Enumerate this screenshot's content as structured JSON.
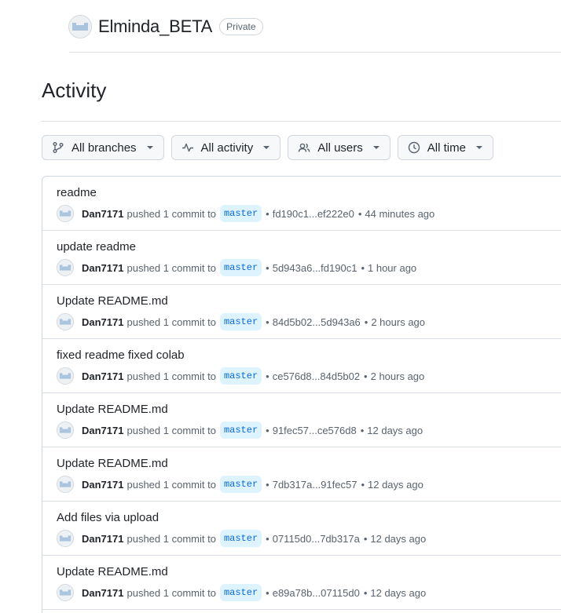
{
  "repo": {
    "name": "Elminda_BETA",
    "visibility": "Private",
    "avatar_icon": "identicon"
  },
  "page": {
    "title": "Activity"
  },
  "filters": [
    {
      "label": "All branches",
      "icon": "git-branch-icon"
    },
    {
      "label": "All activity",
      "icon": "pulse-icon"
    },
    {
      "label": "All users",
      "icon": "people-icon"
    },
    {
      "label": "All time",
      "icon": "clock-icon"
    }
  ],
  "activity": [
    {
      "title": "readme",
      "user": "Dan7171",
      "action": "pushed 1 commit to",
      "branch": "master",
      "range": "fd190c1...ef222e0",
      "time": "44 minutes ago"
    },
    {
      "title": "update readme",
      "user": "Dan7171",
      "action": "pushed 1 commit to",
      "branch": "master",
      "range": "5d943a6...fd190c1",
      "time": "1 hour ago"
    },
    {
      "title": "Update README.md",
      "user": "Dan7171",
      "action": "pushed 1 commit to",
      "branch": "master",
      "range": "84d5b02...5d943a6",
      "time": "2 hours ago"
    },
    {
      "title": "fixed readme fixed colab",
      "user": "Dan7171",
      "action": "pushed 1 commit to",
      "branch": "master",
      "range": "ce576d8...84d5b02",
      "time": "2 hours ago"
    },
    {
      "title": "Update README.md",
      "user": "Dan7171",
      "action": "pushed 1 commit to",
      "branch": "master",
      "range": "91fec57...ce576d8",
      "time": "12 days ago"
    },
    {
      "title": "Update README.md",
      "user": "Dan7171",
      "action": "pushed 1 commit to",
      "branch": "master",
      "range": "7db317a...91fec57",
      "time": "12 days ago"
    },
    {
      "title": "Add files via upload",
      "user": "Dan7171",
      "action": "pushed 1 commit to",
      "branch": "master",
      "range": "07115d0...7db317a",
      "time": "12 days ago"
    },
    {
      "title": "Update README.md",
      "user": "Dan7171",
      "action": "pushed 1 commit to",
      "branch": "master",
      "range": "e89a78b...07115d0",
      "time": "12 days ago"
    }
  ],
  "colors": {
    "branch_text": "#0969da",
    "branch_bg": "#ddf4ff",
    "border": "#d0d7de",
    "muted": "#59636e"
  }
}
